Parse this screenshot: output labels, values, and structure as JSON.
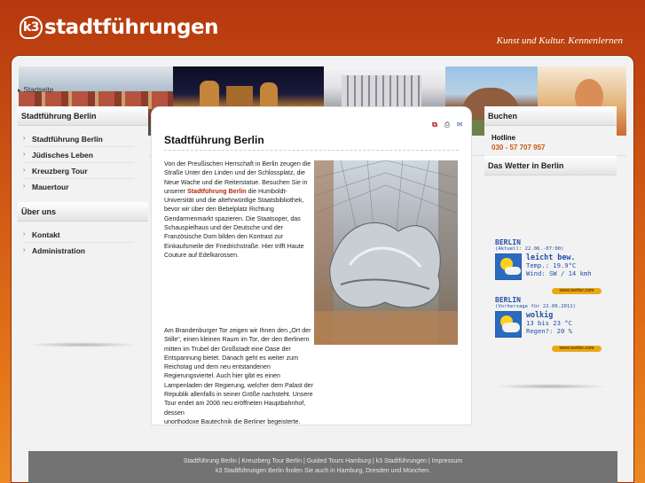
{
  "header": {
    "logo_mark": "k3",
    "logo_text": "stadtführungen",
    "tagline": "Kunst und Kultur. Kennenlernen"
  },
  "breadcrumb": {
    "label": "Startseite"
  },
  "left_sidebar": {
    "section1_title": "Stadtführung Berlin",
    "section1_items": [
      "Stadtführung Berlin",
      "Jüdisches Leben",
      "Kreuzberg Tour",
      "Mauertour"
    ],
    "section2_title": "Über uns",
    "section2_items": [
      "Kontakt",
      "Administration"
    ]
  },
  "content": {
    "title": "Stadtführung Berlin",
    "icons": [
      "pdf-icon",
      "print-icon",
      "email-icon"
    ],
    "para1_before": "Von der Preußischen Herrschaft in Berlin zeugen die Straße Unter den Linden und der Schlossplatz, die Neue Wache und die Reiterstatue. Besuchen Sie in unserer ",
    "para1_bold": "Stadtführung Berlin",
    "para1_after": " die Humboldt-Universität und die altehrwürdige Staatsbibliothek, bevor wir über den Bebelplatz Richtung Gendarmenmarkt spazieren. Die Staatsoper, das Schauspielhaus und der Deutsche und der Französische Dom bilden den Kontrast zur Einkaufsmeile der Friedrichstraße. Hier trifft Haute Couture auf Edelkarossen.",
    "para2_narrow": "Am Brandenburger Tor zeigen wir Ihnen den „Ort der Stille“, einen kleinen Raum im Tor, der den Berlinern mitten im Trubel der Großstadt eine Oase der Entspannung bietet. Danach geht es weiter zum Reichstag und dem neu entstandenen Regierungsviertel. Auch hier gibt es einen Lampenladen der Regierung, welcher dem Palast der Republik allenfalls in seiner Größe nachsteht. Unsere Tour endet am 2006 neu eröffneten Hauptbahnhof, dessen",
    "para2_last": "unorthodoxe Bautechnik die Berliner begeisterte."
  },
  "right_sidebar": {
    "booking_title": "Buchen",
    "hotline_label": "Hotline",
    "hotline_number": "030 - 57 707 957",
    "weather_title": "Das Wetter in Berlin",
    "weather": [
      {
        "city": "BERLIN",
        "subtitle": "(Aktuell: 22.06.-07:00)",
        "condition": "leicht bew.",
        "line2": "Temp.: 19.9°C",
        "line3": "Wind: SW / 14 kmh",
        "badge": "www.wetter.com"
      },
      {
        "city": "BERLIN",
        "subtitle": "(Vorhersage für 22.06.2011)",
        "condition": "wolkig",
        "line2": "13 bis 23 °C",
        "line3": "Regen?: 20 %",
        "badge": "www.wetter.com"
      }
    ]
  },
  "footer": {
    "links_line": "Stadtführung Berlin | Kreuzberg Tour Berlin | Guided Tours Hamburg | k3 Stadtführungen | Impressum",
    "info_line": "k3 Stadtführungen Berlin finden Sie auch in Hamburg, Dresden und München."
  }
}
